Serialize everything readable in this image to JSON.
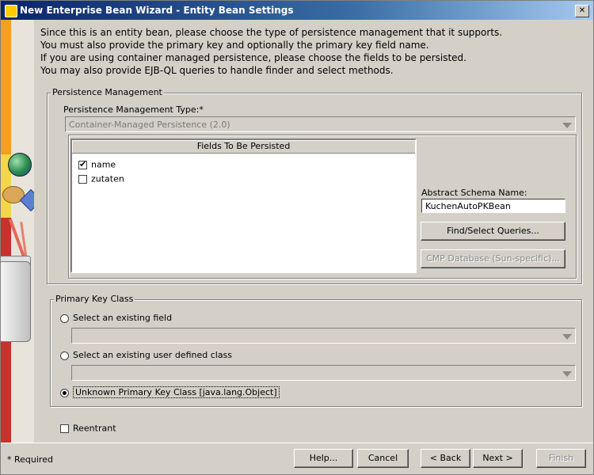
{
  "window": {
    "title": "New Enterprise Bean Wizard - Entity Bean Settings"
  },
  "intro_lines": [
    "Since this is an entity bean, please choose the type of persistence management that it supports.",
    "You must also provide the primary key and optionally the primary key field name.",
    "If you are using container managed persistence, please choose the fields to be persisted.",
    "You may also provide EJB-QL queries to handle finder and select methods."
  ],
  "persistence": {
    "legend": "Persistence Management",
    "type_label": "Persistence Management Type:*",
    "type_value": "Container-Managed Persistence (2.0)",
    "fields_header": "Fields To Be Persisted",
    "fields": [
      {
        "name": "name",
        "checked": true
      },
      {
        "name": "zutaten",
        "checked": false
      }
    ],
    "schema_label": "Abstract Schema Name:",
    "schema_value": "KuchenAutoPKBean",
    "find_queries_label": "Find/Select Queries...",
    "cmp_database_label": "CMP Database (Sun-specific)..."
  },
  "primary_key": {
    "legend": "Primary Key Class",
    "option_existing_field": "Select an existing field",
    "option_user_class": "Select an existing user defined class",
    "option_unknown": "Unknown Primary Key Class [java.lang.Object]",
    "selected": "unknown",
    "existing_field_value": "",
    "user_class_value": ""
  },
  "reentrant": {
    "label": "Reentrant",
    "checked": false
  },
  "footer": {
    "required_note": "* Required",
    "help": "Help...",
    "cancel": "Cancel",
    "back": "< Back",
    "next": "Next >",
    "finish": "Finish"
  }
}
